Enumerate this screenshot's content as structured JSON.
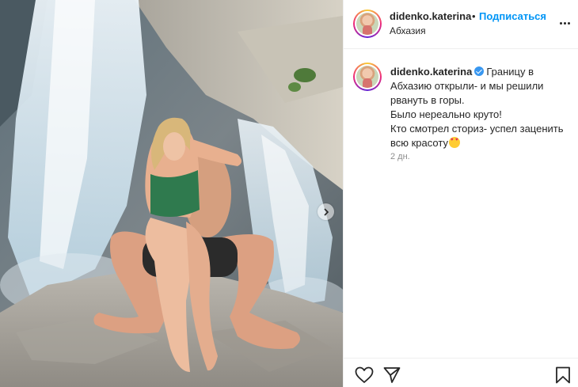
{
  "post": {
    "username": "didenko.katerina",
    "separator": "•",
    "follow_label": "Подписаться",
    "location": "Абхазия"
  },
  "caption": {
    "username": "didenko.katerina",
    "verified": true,
    "line1": "Границу в Абхазию открыли- и мы решили рвануть в горы.",
    "line2": "Было нереально круто!",
    "line3": "Кто смотрел сториз- успел заценить всю красоту",
    "emoji": "heart-eyes-emoji",
    "time": "2 дн."
  },
  "colors": {
    "accent": "#0095f6",
    "text": "#262626",
    "muted": "#8e8e8e",
    "verified": "#3897f0"
  },
  "icons": {
    "more": "more-horizontal-icon",
    "carousel_next": "chevron-right-icon",
    "like": "heart-outline-icon",
    "share": "paper-plane-icon",
    "save": "bookmark-outline-icon"
  }
}
